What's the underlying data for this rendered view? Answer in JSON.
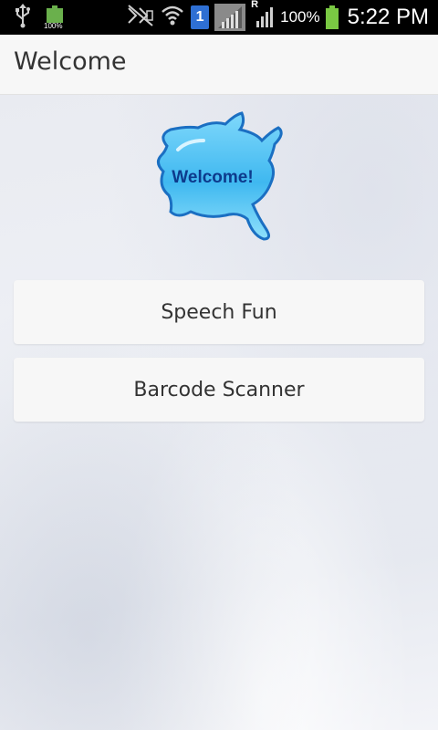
{
  "status_bar": {
    "battery_small_label": "100%",
    "sim_label": "1",
    "roaming_label": "R",
    "battery_percent": "100%",
    "time": "5:22 PM",
    "icons": [
      "usb-icon",
      "battery-icon",
      "mute-icon",
      "wifi-icon",
      "sim-icon",
      "signal-icon",
      "signal-icon",
      "battery-icon"
    ]
  },
  "app_bar": {
    "title": "Welcome"
  },
  "logo": {
    "text": "Welcome!"
  },
  "buttons": {
    "speech_fun": "Speech Fun",
    "barcode_scanner": "Barcode Scanner"
  },
  "colors": {
    "logo_blue": "#4fc3f7",
    "logo_text": "#0d3a8c",
    "battery_green": "#7ac943",
    "sim_blue": "#2e6fd3"
  }
}
